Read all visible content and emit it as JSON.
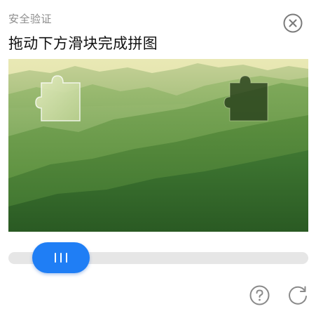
{
  "header": {
    "subtitle": "安全验证",
    "title": "拖动下方滑块完成拼图"
  },
  "icons": {
    "close": "close-circle-icon",
    "help": "help-circle-icon",
    "refresh": "refresh-icon",
    "grip": "grip-lines-icon"
  },
  "slider": {
    "handle_color": "#1f7ef5",
    "track_color": "#e6e6e6"
  },
  "image": {
    "description_tag": "green-mountain-landscape"
  }
}
